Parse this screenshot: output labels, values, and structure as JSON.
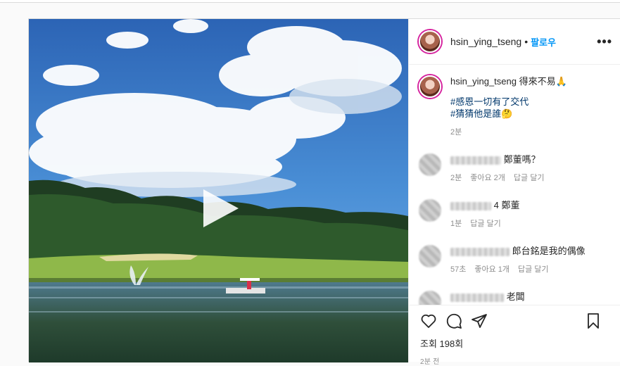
{
  "post": {
    "username": "hsin_ying_tseng",
    "follow_label": "팔로우",
    "more_label": "•••",
    "caption": {
      "text": "得來不易🙏",
      "tags": [
        "#感恩一切有了交代",
        "#猜猜他是誰🤔"
      ],
      "time": "2분"
    },
    "comments": [
      {
        "text": "鄭董嗎？",
        "time": "2분",
        "likes": "좋아요 2개",
        "reply": "답글 달기"
      },
      {
        "text": "4 鄭董",
        "time": "1분",
        "likes": "",
        "reply": "답글 달기"
      },
      {
        "text": "郎台銘是我的偶像",
        "time": "57초",
        "likes": "좋아요 1개",
        "reply": "답글 달기"
      },
      {
        "text": "老闆",
        "time": "",
        "likes": "",
        "reply": ""
      }
    ],
    "views": "조회 198회",
    "posted_ago": "2분 전"
  },
  "icons": {
    "like": "heart-icon",
    "comment": "comment-bubble-icon",
    "share": "paper-plane-icon",
    "save": "bookmark-icon",
    "play": "play-icon",
    "more": "more-options-icon"
  },
  "colors": {
    "follow": "#0095f6",
    "link": "#00376b",
    "muted": "#8e8e8e"
  }
}
